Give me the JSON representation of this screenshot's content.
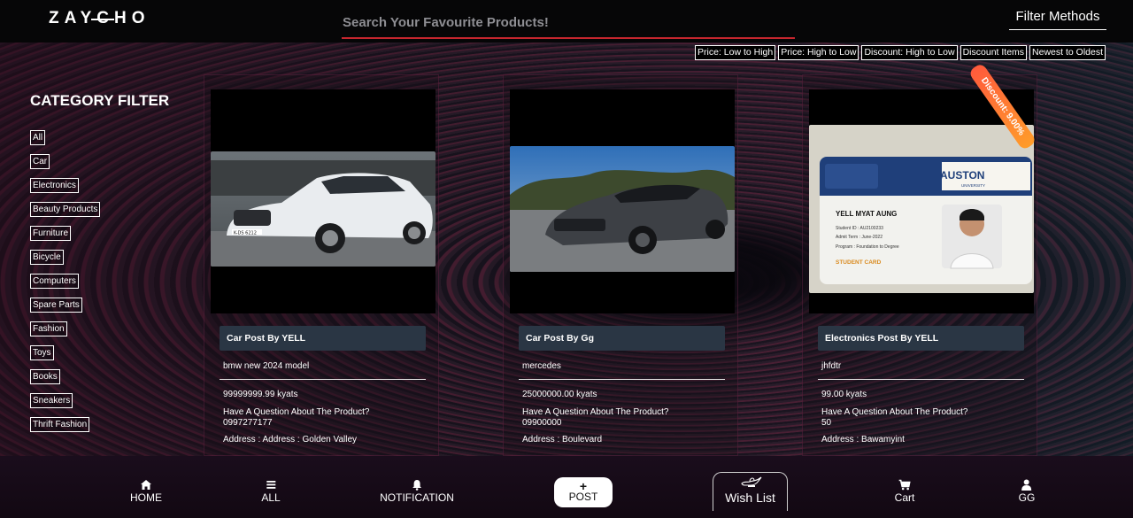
{
  "header": {
    "logo": "ZAYCHO",
    "search_placeholder": "Search Your Favourite Products!",
    "filter_methods": "Filter Methods"
  },
  "sort_options": [
    "Price: Low to High",
    "Price: High to Low",
    "Discount: High to Low",
    "Discount Items",
    "Newest to Oldest"
  ],
  "category_filter": {
    "title": "CATEGORY FILTER",
    "items": [
      "All",
      "Car",
      "Electronics",
      "Beauty Products",
      "Furniture",
      "Bicycle",
      "Computers",
      "Spare Parts",
      "Fashion",
      "Toys",
      "Books",
      "Sneakers",
      "Thrift Fashion"
    ]
  },
  "products": [
    {
      "heading": "Car Post By YELL",
      "description": "bmw new 2024 model",
      "price": "99999999.99 kyats",
      "question": "Have A Question About The Product?",
      "phone": "0997277177",
      "address": "Address : Address : Golden Valley",
      "image": "white-car-photo",
      "plate": "K-DS 6212"
    },
    {
      "heading": "Car Post By Gg",
      "description": "mercedes",
      "price": "25000000.00 kyats",
      "question": "Have A Question About The Product?",
      "phone": "09900000",
      "address": "Address : Boulevard",
      "image": "grey-car-photo"
    },
    {
      "heading": "Electronics Post By YELL",
      "description": "jhfdtr",
      "price": "99.00 kyats",
      "question": "Have A Question About The Product?",
      "phone": "50",
      "address": "Address : Bawamyint",
      "image": "student-id-card-photo",
      "badge": "Discount: 9.00%",
      "id_card": {
        "university": "AUSTON",
        "university_sub": "UNIVERSITY",
        "name": "YELL MYAT AUNG",
        "student_id": "Student ID : AU2100233",
        "admit_term": "Admit Term : June-2022",
        "program": "Program : Foundation to Degree",
        "card_label": "STUDENT CARD"
      }
    }
  ],
  "bottom_nav": {
    "home": "HOME",
    "all": "ALL",
    "notification": "NOTIFICATION",
    "post_plus": "+",
    "post": "POST",
    "wishlist": "Wish List",
    "cart": "Cart",
    "user": "GG"
  },
  "colors": {
    "accent_red": "#c6262e",
    "card_header": "#2a3644",
    "badge_orange": "#ff7a33"
  }
}
